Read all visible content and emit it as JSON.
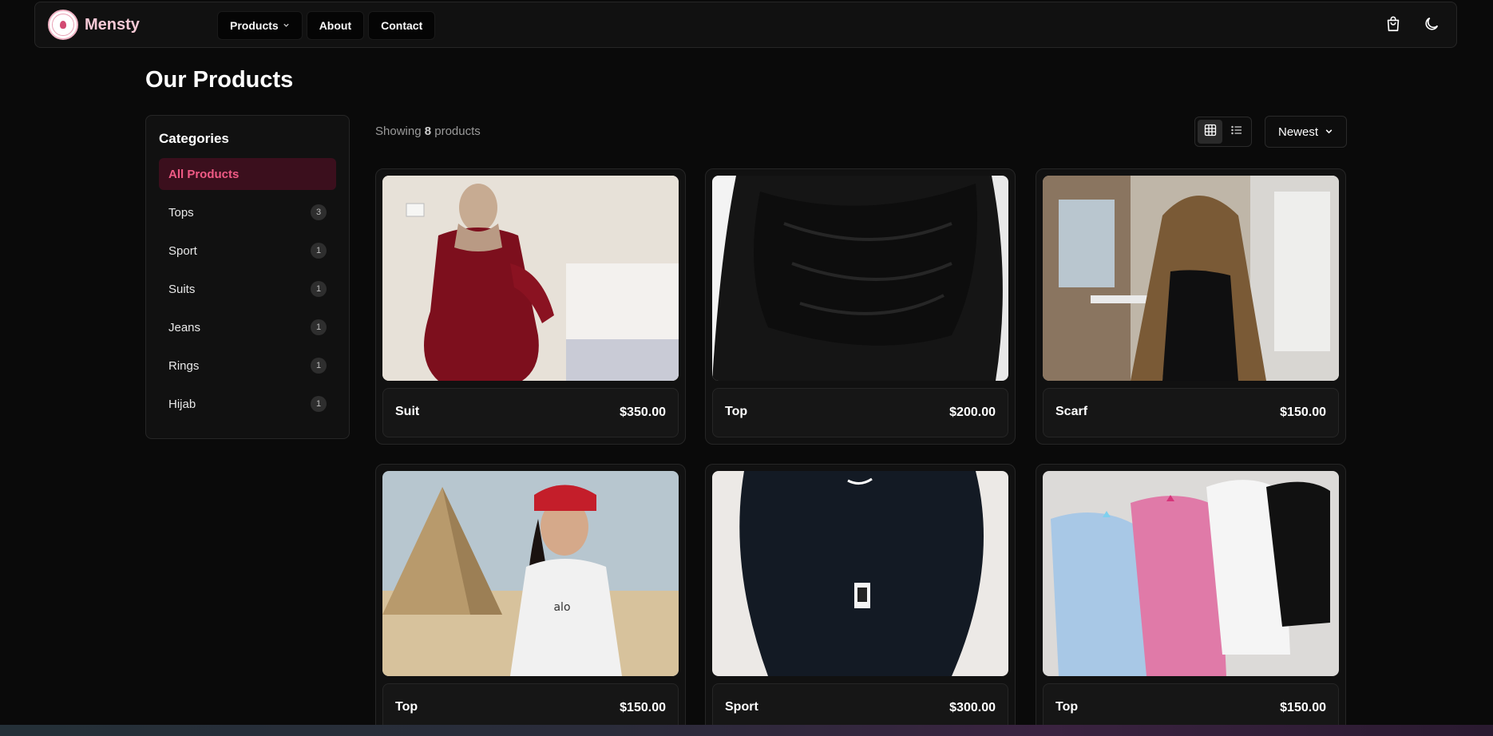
{
  "brand": {
    "name": "Mensty",
    "logo_text": "MENSTY"
  },
  "nav": {
    "links": [
      {
        "label": "Products",
        "has_dropdown": true
      },
      {
        "label": "About"
      },
      {
        "label": "Contact"
      }
    ],
    "icons": [
      "shopping-bag-icon",
      "moon-icon"
    ]
  },
  "page": {
    "title": "Our Products"
  },
  "sidebar": {
    "heading": "Categories",
    "items": [
      {
        "label": "All Products",
        "count": "",
        "active": true
      },
      {
        "label": "Tops",
        "count": "3"
      },
      {
        "label": "Sport",
        "count": "1"
      },
      {
        "label": "Suits",
        "count": "1"
      },
      {
        "label": "Jeans",
        "count": "1"
      },
      {
        "label": "Rings",
        "count": "1"
      },
      {
        "label": "Hijab",
        "count": "1"
      }
    ]
  },
  "toolbar": {
    "showing_prefix": "Showing",
    "showing_count": "8",
    "showing_suffix": "products",
    "view_modes": [
      "grid-view-icon",
      "list-view-icon"
    ],
    "active_view": "grid",
    "sort_value": "Newest"
  },
  "products": [
    {
      "name": "Suit",
      "price": "$350.00"
    },
    {
      "name": "Top",
      "price": "$200.00"
    },
    {
      "name": "Scarf",
      "price": "$150.00"
    },
    {
      "name": "Top",
      "price": "$150.00"
    },
    {
      "name": "Sport",
      "price": "$300.00"
    },
    {
      "name": "Top",
      "price": "$150.00"
    }
  ],
  "colors": {
    "accent": "#f05a85",
    "accent_bg": "#3b0f1d",
    "background": "#0a0a0a",
    "card": "#111111"
  }
}
